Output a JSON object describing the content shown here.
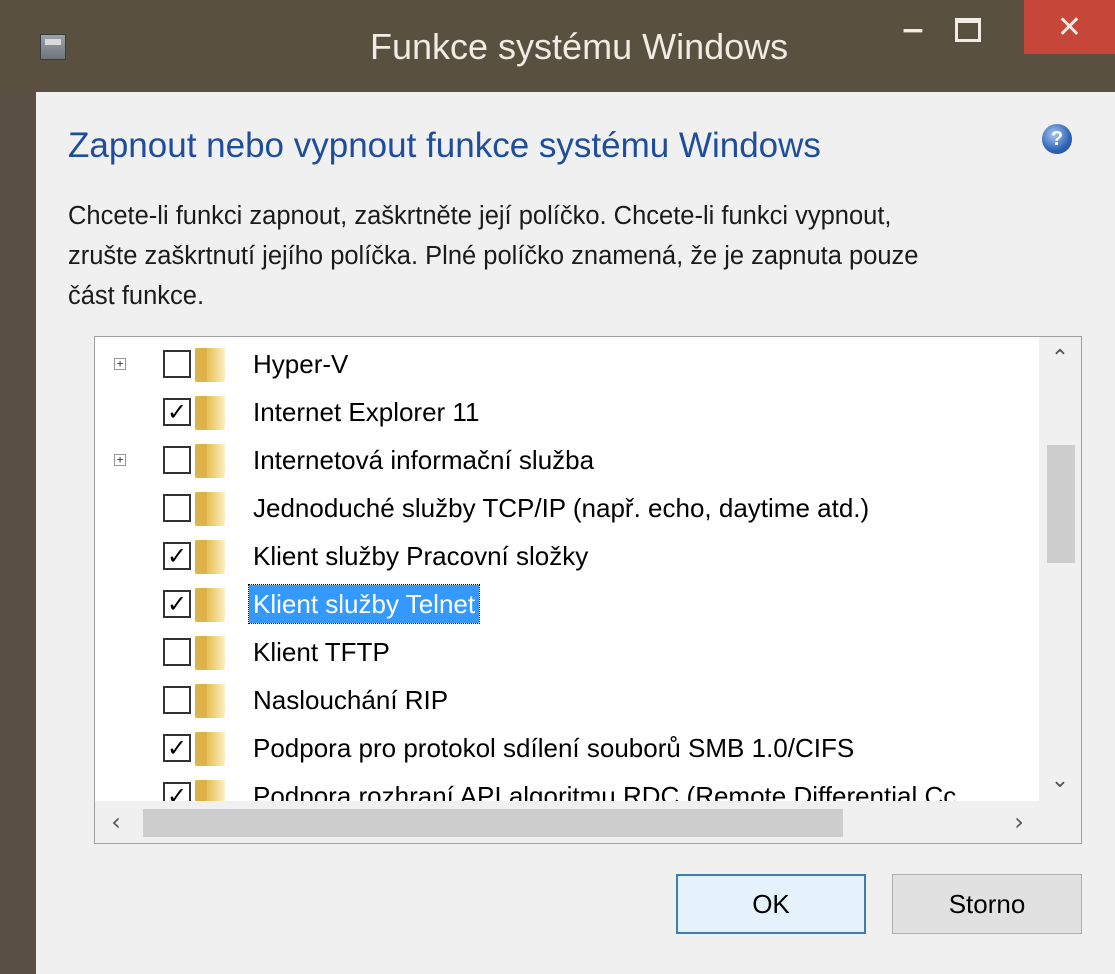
{
  "window": {
    "title": "Funkce systému Windows",
    "minimize_glyph": "−",
    "close_glyph": "✕"
  },
  "header": {
    "heading": "Zapnout nebo vypnout funkce systému Windows",
    "help_glyph": "?"
  },
  "description": {
    "line1": "Chcete-li funkci zapnout, zaškrtněte její políčko. Chcete-li funkci vypnout,",
    "line2": "zrušte zaškrtnutí jejího políčka. Plné políčko znamená, že je zapnuta pouze",
    "line3": "část funkce."
  },
  "features": [
    {
      "label": "Hyper-V",
      "checked": false,
      "expandable": true,
      "selected": false
    },
    {
      "label": "Internet Explorer 11",
      "checked": true,
      "expandable": false,
      "selected": false
    },
    {
      "label": "Internetová informační služba",
      "checked": false,
      "expandable": true,
      "selected": false
    },
    {
      "label": "Jednoduché služby TCP/IP (např. echo, daytime atd.)",
      "checked": false,
      "expandable": false,
      "selected": false
    },
    {
      "label": "Klient služby Pracovní složky",
      "checked": true,
      "expandable": false,
      "selected": false
    },
    {
      "label": "Klient služby Telnet",
      "checked": true,
      "expandable": false,
      "selected": true
    },
    {
      "label": "Klient TFTP",
      "checked": false,
      "expandable": false,
      "selected": false
    },
    {
      "label": "Naslouchání RIP",
      "checked": false,
      "expandable": false,
      "selected": false
    },
    {
      "label": "Podpora pro protokol sdílení souborů SMB 1.0/CIFS",
      "checked": true,
      "expandable": false,
      "selected": false
    },
    {
      "label": "Podpora rozhraní API algoritmu RDC (Remote Differential Cc",
      "checked": true,
      "expandable": false,
      "selected": false
    }
  ],
  "buttons": {
    "ok": "OK",
    "cancel": "Storno"
  },
  "colors": {
    "heading": "#1e4d9a",
    "selection": "#3399ff",
    "close": "#c7463a"
  },
  "icons": [
    "app-icon",
    "help-icon",
    "expander-plus-icon",
    "folder-icon",
    "check-icon",
    "chevron-up-icon",
    "chevron-down-icon",
    "chevron-left-icon",
    "chevron-right-icon"
  ]
}
